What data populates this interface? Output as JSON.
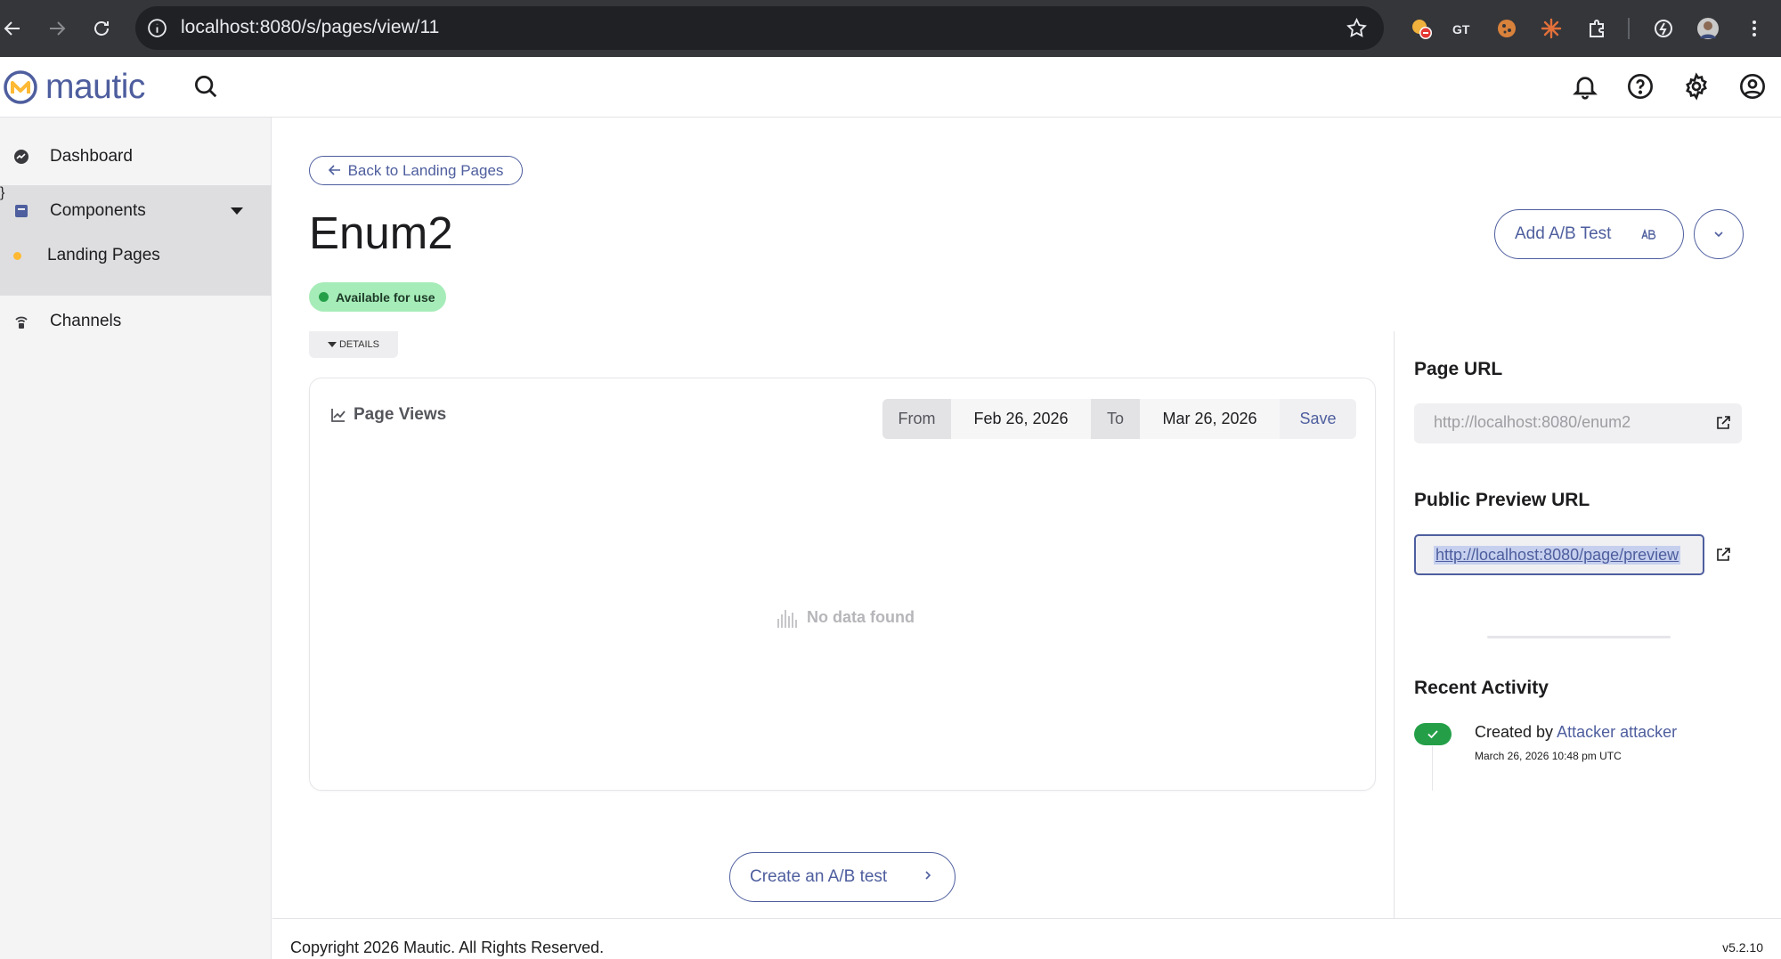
{
  "browser": {
    "url": "localhost:8080/s/pages/view/11"
  },
  "app": {
    "logo_text": "mautic",
    "version": "v5.2.10",
    "copyright": "Copyright 2026 Mautic. All Rights Reserved."
  },
  "sidebar": {
    "items": [
      {
        "label": "Dashboard",
        "icon": "dashboard-icon"
      },
      {
        "label": "Components",
        "icon": "components-icon",
        "expanded": true
      },
      {
        "label": "Landing Pages",
        "icon": "dot-icon",
        "active": true
      },
      {
        "label": "Channels",
        "icon": "channels-icon"
      }
    ]
  },
  "main": {
    "back_label": "Back to Landing Pages",
    "title": "Enum2",
    "status": "Available for use",
    "add_ab_label": "Add A/B Test",
    "details_label": "DETAILS",
    "chart": {
      "title": "Page Views",
      "from_label": "From",
      "from_value": "Feb 26, 2026",
      "to_label": "To",
      "to_value": "Mar 26, 2026",
      "save_label": "Save",
      "empty_text": "No data found"
    },
    "create_ab_label": "Create an A/B test"
  },
  "right_panel": {
    "page_url_heading": "Page URL",
    "page_url": "http://localhost:8080/enum2",
    "preview_url_heading": "Public Preview URL",
    "preview_url": "http://localhost:8080/page/preview",
    "activity_heading": "Recent Activity",
    "activity": {
      "prefix": "Created by",
      "user": "Attacker attacker",
      "time": "March 26, 2026 10:48 pm UTC"
    }
  },
  "colors": {
    "brand": "#4e5e9e",
    "status_green": "#249f48",
    "status_bg": "#a6ecb8",
    "accent_yellow": "#fdb933"
  }
}
